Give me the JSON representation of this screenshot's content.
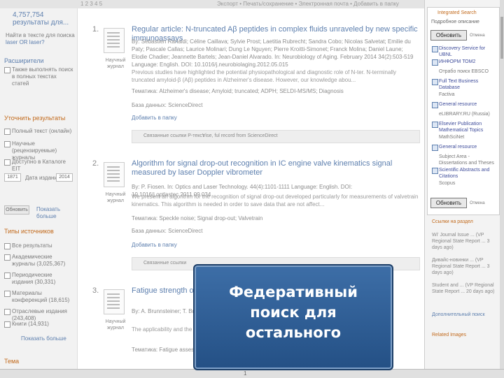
{
  "header": {
    "pages": "1 2 3 4 5",
    "tools": "Экспорт • Печать/сохранение • Электронная почта • Добавить в папку"
  },
  "sidebar": {
    "count": "4,757,754 результаты для...",
    "count_sub": "",
    "no_results_note": "Найти в тексте для поиска",
    "laser_link": "laser OR laser?",
    "expanders_heading": "Расширители",
    "expander_label": "Также выполнять поиск в полных текстах статей",
    "refine_heading": "Уточнить результаты",
    "filters": [
      {
        "label": "Полный текст (онлайн)"
      },
      {
        "label": "Научные (рецензируемые) журналы"
      },
      {
        "label": "Доступно в Каталоге EIT"
      }
    ],
    "date_from": "1871",
    "date_label": "Дата издания",
    "date_to": "2014",
    "update_button": "Обновить",
    "show_more": "Показать больше",
    "source_heading": "Типы источников",
    "sources": [
      {
        "label": "Все результаты"
      },
      {
        "label": "Академические журналы (3,025,367)"
      },
      {
        "label": "Периодические издания (30,331)"
      },
      {
        "label": "Материалы конференций (18,615)"
      },
      {
        "label": "Отраслевые издания (243,408)"
      },
      {
        "label": "Книги (14,931)"
      }
    ],
    "show_more_2": "Показать больше",
    "topic_heading": "Тема"
  },
  "results": [
    {
      "num": "1.",
      "type": "Научный журнал",
      "title": "Regular article: N-truncated Aβ peptides in complex fluids unraveled by new specific immunoassays",
      "authors": "By: Sébastien Ranaldi; Céline Caillava; Sylvie Prost; Laetitia Rubrecht; Sandra Cobo; Nicolas Salvetat; Emilie du Paty; Pascale Callas; Laurice Molinari; Dung Le Nguyen; Pierre Kroitti-Simonet; Franck Molina; Daniel Laune; Elodie Chadier; Jeannette Bartels; Jean-Daniel Alvarado. In: Neurobiology of Aging. February 2014 34(2):503-519 Language: English. DOI: 10.1016/j.neurobiolaging.2012.05.015",
      "abstract": "Previous studies have highlighted the potential physiopathological and diagnostic role of N-ter. N-terminally truncated amyloid-β (Aβ) peptides in Alzheimer's disease. However, our knowledge abou...",
      "subjects": "Тематика: Alzheimer's disease; Amyloid; truncated; ADPH; SELDI-MS/MS; Diagnosis",
      "database": "База данных: ScienceDirect",
      "add": "Добавить в папку",
      "action1": "Связанные ссылки Р-текст",
      "action2": "Vise, ful record from ScienceDirect"
    },
    {
      "num": "2.",
      "type": "Научный журнал",
      "title": "Algorithm for signal drop-out recognition in IC engine valve kinematics signal measured by laser Doppler vibrometer",
      "authors": "By: P. Fiosen. In: Optics and Laser Technology. 44(4):1101-1111 Language: English. DOI: 10.1016/j.optlastec.2011.09.034",
      "abstract": "We present an algorithm for the recognition of signal drop-out developed particularly for measurements of valvetrain kinematics. This algorithm is needed in order to save data that are not affect...",
      "subjects": "Тематика: Speckle noise; Signal drop-out; Valvetrain",
      "database": "База данных: ScienceDirect",
      "add": "Добавить в папку",
      "action1": "Связанные ссылки",
      "action2": ""
    },
    {
      "num": "3.",
      "type": "Научный журнал",
      "title": "Fatigue strength of laser ... sing size effects",
      "authors": "By: A. Brunnsteiner; T. Brueckl ... In: Journal of ... Applications. International ...",
      "abstract": "The applicability and the q... fatigue strength of laser bea...",
      "subjects": "Тематика: Fatigue assessm...",
      "database": "",
      "add": "",
      "action1": "",
      "action2": ""
    }
  ],
  "integrated_search": {
    "title": "Integrated Search",
    "detail_link": "Подробное описание",
    "top_button": "Обновить",
    "top_side": "Отмена",
    "items": [
      {
        "label": "Discovery Service for UBNL",
        "tone": "blue"
      },
      {
        "label": "ИНФОРМ ТОМ2",
        "tone": "blue"
      },
      {
        "label": "Отрабо поиск EBSCO",
        "tone": "gray"
      },
      {
        "label": "Full Text Business Database",
        "tone": "blue"
      },
      {
        "label": "Factiva",
        "tone": "gray"
      },
      {
        "label": "General resource",
        "tone": "blue"
      },
      {
        "label": "eLIBRARY.RU (Russia)",
        "tone": "gray"
      },
      {
        "label": "Elsevier Publication Mathematical Topics",
        "tone": "blue"
      },
      {
        "label": "MathSciNet",
        "tone": "gray"
      },
      {
        "label": "General resource",
        "tone": "blue"
      },
      {
        "label": "Subject Area - Dissertations and Theses",
        "tone": "gray"
      },
      {
        "label": "Scientific Abstracts and Citations",
        "tone": "blue"
      },
      {
        "label": "Scopus",
        "tone": "gray"
      }
    ],
    "bottom_button": "Обновить",
    "bottom_side": "Отмена"
  },
  "right_extra": {
    "heading": "Ссылки на раздел",
    "texts": [
      "Wi' Journal Issue ... (VP Regional State Report ... 3 days ago)",
      "Дивайс-новинки ... (VP Regional State Report ... 3 days ago)",
      "Student and ... (VP Regional State Report ... 20 days ago)"
    ],
    "more": "Дополнительный поиск",
    "heading2": "Related Images"
  },
  "footer": {
    "page": "1"
  },
  "overlay": {
    "line1": "Федеративный",
    "line2": "поиск для",
    "line3": "остального"
  }
}
